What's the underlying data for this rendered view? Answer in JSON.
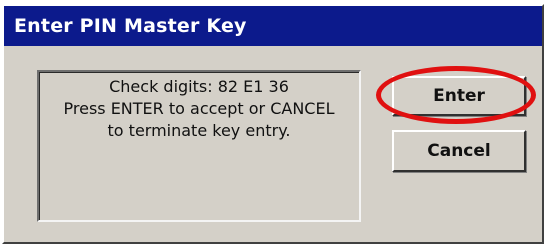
{
  "dialog": {
    "title": "Enter PIN Master Key",
    "message_lines": [
      "Check digits: 82 E1 36",
      "Press ENTER to accept or CANCEL",
      "to terminate key entry."
    ],
    "buttons": {
      "enter_label": "Enter",
      "cancel_label": "Cancel"
    }
  },
  "colors": {
    "titlebar": "#0c1a8c",
    "dialog_background": "#d4d0c8",
    "highlight_ring": "#e01010"
  }
}
